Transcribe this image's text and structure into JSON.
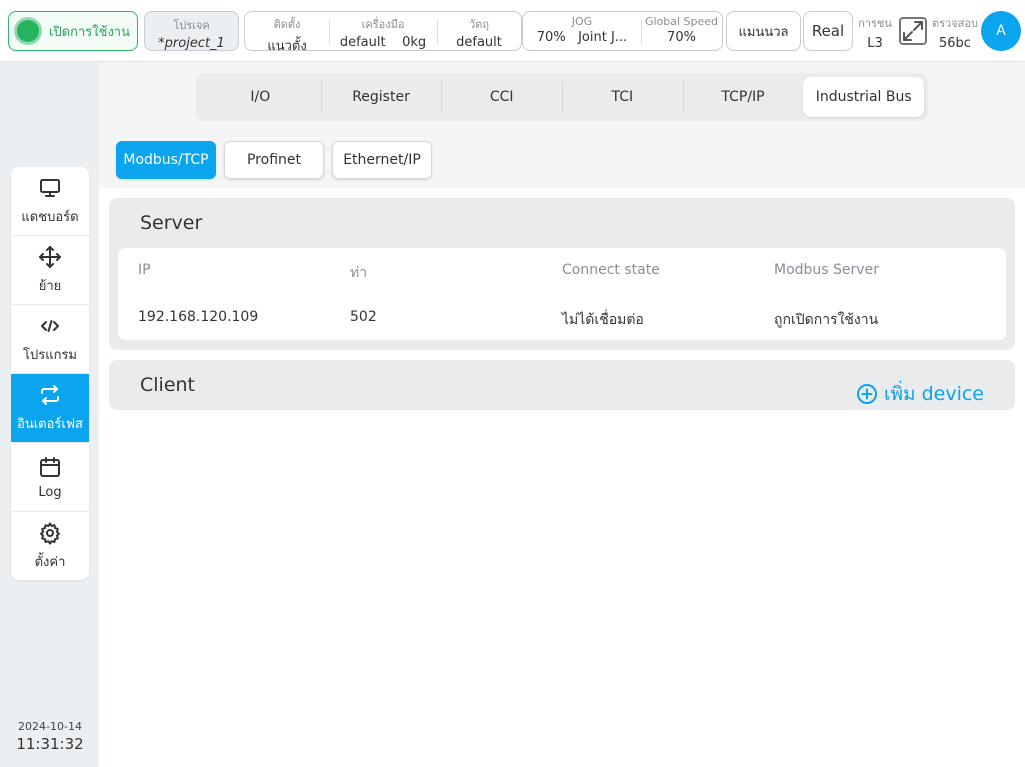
{
  "topbar": {
    "power_label": "เปิดการใช้งาน",
    "project_label": "โปรเจค",
    "project_value": "*project_1",
    "install_label": "ติดตั้ง",
    "install_value": "แนวตั้ง",
    "tool_label": "เครื่องมือ",
    "tool_value": "default",
    "tool_weight": "0kg",
    "object_label": "วัตถุ",
    "object_value": "default",
    "jog_label": "JOG",
    "jog_value": "70%",
    "jog_mode": "Joint J...",
    "global_speed_label": "Global Speed",
    "global_speed_value": "70%",
    "manual_label": "แมนนวล",
    "real_label": "Real",
    "collision_label": "การชน",
    "collision_value": "L3",
    "check_label": "ตรวจสอบ",
    "check_value": "56bc",
    "avatar_letter": "A",
    "accent_color": "#0aa4ef",
    "power_color": "#26b35f"
  },
  "sidebar": {
    "items": [
      {
        "label": "แดชบอร์ด",
        "icon": "monitor-icon"
      },
      {
        "label": "ย้าย",
        "icon": "move-icon"
      },
      {
        "label": "โปรแกรม",
        "icon": "code-icon"
      },
      {
        "label": "อินเตอร์เฟส",
        "icon": "exchange-icon"
      },
      {
        "label": "Log",
        "icon": "calendar-icon"
      },
      {
        "label": "ตั้งค่า",
        "icon": "gear-icon"
      }
    ],
    "date": "2024-10-14",
    "time": "11:31:32"
  },
  "tabs": [
    "I/O",
    "Register",
    "CCI",
    "TCI",
    "TCP/IP",
    "Industrial Bus"
  ],
  "subtabs": [
    "Modbus/TCP",
    "Profinet",
    "Ethernet/IP"
  ],
  "server": {
    "title": "Server",
    "headers": [
      "IP",
      "ท่า",
      "Connect state",
      "Modbus Server"
    ],
    "row": [
      "192.168.120.109",
      "502",
      "ไม่ได้เชื่อมต่อ",
      "ถูกเปิดการใช้งาน"
    ]
  },
  "client": {
    "title": "Client",
    "add_label": "เพิ่ม device"
  }
}
